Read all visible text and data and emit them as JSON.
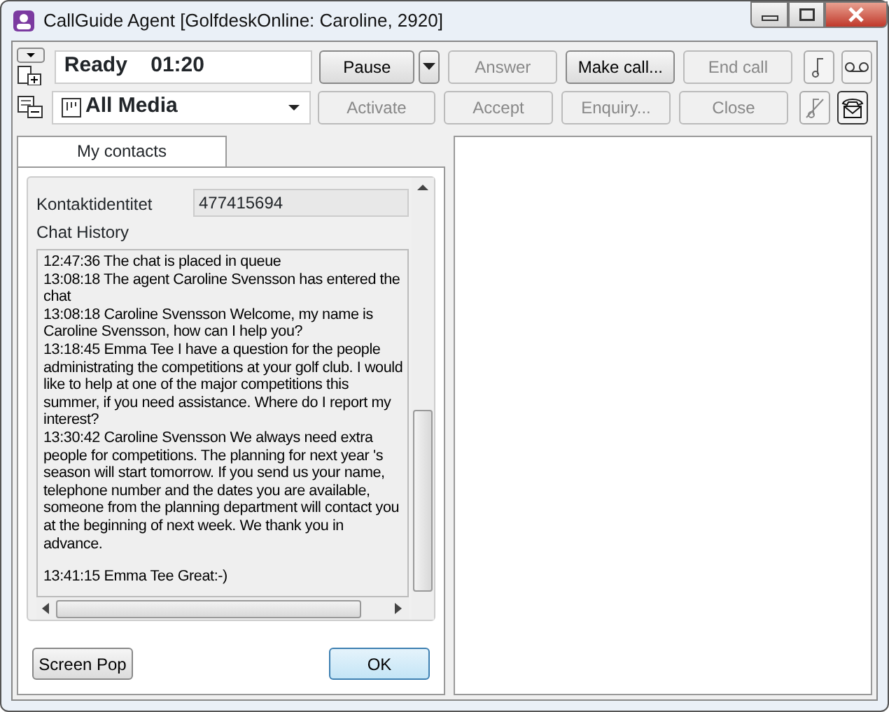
{
  "window": {
    "title": "CallGuide Agent [GolfdeskOnline: Caroline, 2920]"
  },
  "status": {
    "state": "Ready",
    "timer": "01:20"
  },
  "media": {
    "value": "All Media"
  },
  "toolbar_row_1": [
    {
      "label": "Pause",
      "disabled": false,
      "has_menu": true
    },
    {
      "label": "Answer",
      "disabled": true
    },
    {
      "label": "Make call...",
      "disabled": false
    },
    {
      "label": "End call",
      "disabled": true
    }
  ],
  "toolbar_row_2": [
    {
      "label": "Activate",
      "disabled": true
    },
    {
      "label": "Accept",
      "disabled": true
    },
    {
      "label": "Enquiry...",
      "disabled": true
    },
    {
      "label": "Close",
      "disabled": true
    }
  ],
  "tabs": [
    {
      "label": "My contacts",
      "selected": true
    }
  ],
  "contact": {
    "label": "Kontaktidentitet",
    "value": "477415694"
  },
  "chat": {
    "label": "Chat History",
    "messages": [
      {
        "text": "12:47:36  The chat is placed in queue",
        "spaced": false
      },
      {
        "text": "13:08:18  The agent Caroline Svensson has entered the chat",
        "spaced": false
      },
      {
        "text": "13:08:18 Caroline Svensson Welcome, my name is Caroline Svensson, how can I help you?",
        "spaced": false
      },
      {
        "text": "13:18:45 Emma Tee I have a question for the people administrating the competitions at your golf club. I would like to help at one of the major competitions this summer, if you need assistance. Where do I report my interest?",
        "spaced": false
      },
      {
        "text": "13:30:42 Caroline Svensson We always need extra people for competitions. The planning for next year 's season will start tomorrow. If you send us your name, telephone number and the dates you are available, someone from the planning department will contact you at the beginning of next week. We thank you in advance.",
        "spaced": false
      },
      {
        "text": "13:41:15 Emma Tee Great:-)",
        "spaced": true
      }
    ]
  },
  "footer_buttons": [
    {
      "label": "Screen Pop",
      "kind": "plain"
    },
    {
      "label": "OK",
      "kind": "default"
    }
  ]
}
